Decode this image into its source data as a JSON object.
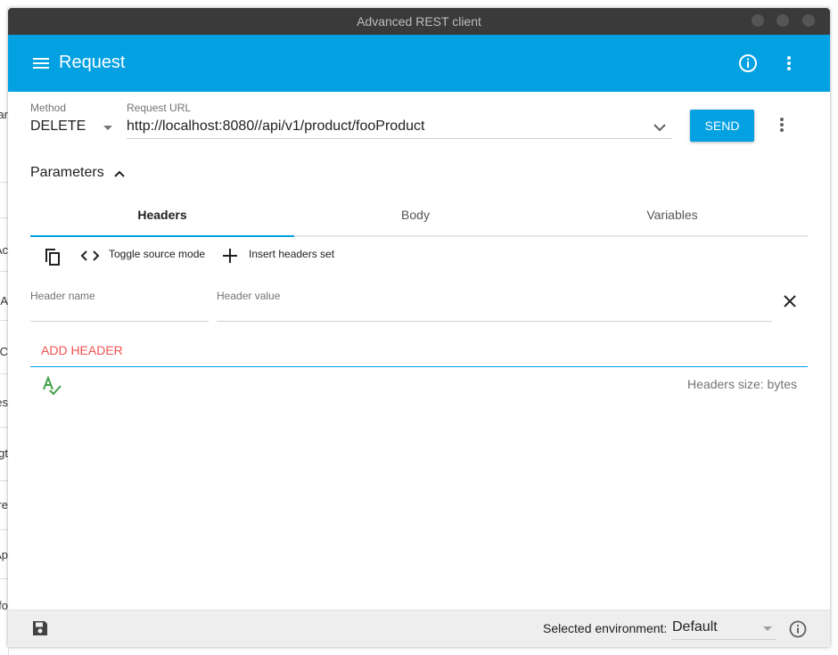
{
  "window": {
    "title": "Advanced REST client"
  },
  "appbar": {
    "title": "Request"
  },
  "request": {
    "method_label": "Method",
    "method_value": "DELETE",
    "url_label": "Request URL",
    "url_value": "http://localhost:8080//api/v1/product/fooProduct",
    "send_label": "SEND"
  },
  "parameters": {
    "label": "Parameters"
  },
  "tabs": [
    {
      "label": "Headers",
      "active": true
    },
    {
      "label": "Body",
      "active": false
    },
    {
      "label": "Variables",
      "active": false
    }
  ],
  "toolbar": {
    "toggle_source_label": "Toggle source mode",
    "insert_headers_label": "Insert headers set"
  },
  "header_form": {
    "name_placeholder": "Header name",
    "value_placeholder": "Header value",
    "add_label": "ADD HEADER",
    "size_text": "Headers size: bytes"
  },
  "footer": {
    "env_label": "Selected environment:",
    "env_value": "Default"
  },
  "background_window": {
    "fragments": [
      "ar",
      "Ac",
      "t A",
      "C",
      "es",
      "gt",
      "re",
      "Ap",
      "fo"
    ]
  },
  "icons": {
    "menu": "menu-icon",
    "info": "info-icon",
    "more": "more-vert-icon",
    "chevron_down": "chevron-down-icon",
    "chevron_up": "chevron-up-icon",
    "copy": "copy-icon",
    "code": "code-icon",
    "add": "add-icon",
    "close": "close-icon",
    "spellcheck": "spellcheck-icon",
    "save": "save-icon"
  },
  "colors": {
    "primary": "#03a1e2",
    "accent_red": "#ef5350",
    "spellcheck_green": "#43a047",
    "titlebar": "#3a3a3a"
  }
}
